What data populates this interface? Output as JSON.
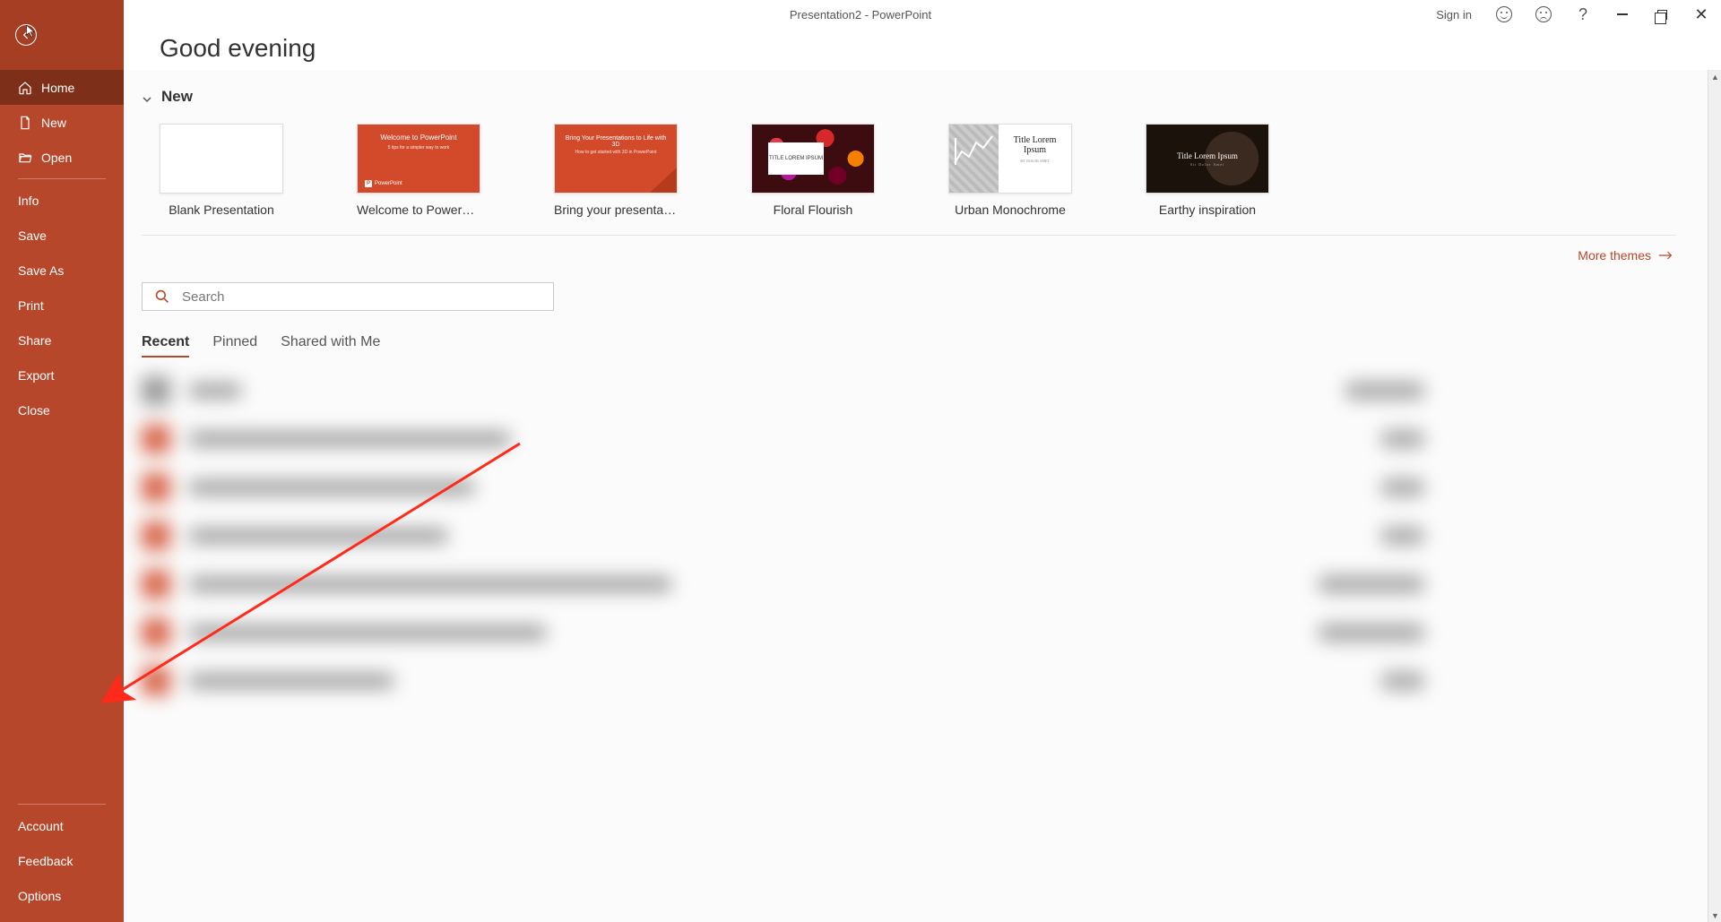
{
  "titlebar": {
    "title": "Presentation2  -  PowerPoint",
    "signin": "Sign in"
  },
  "sidebar": {
    "primary": [
      {
        "label": "Home",
        "icon": "home",
        "active": true
      },
      {
        "label": "New",
        "icon": "new",
        "active": false
      },
      {
        "label": "Open",
        "icon": "open",
        "active": false
      }
    ],
    "secondary": [
      {
        "label": "Info"
      },
      {
        "label": "Save"
      },
      {
        "label": "Save As"
      },
      {
        "label": "Print"
      },
      {
        "label": "Share"
      },
      {
        "label": "Export"
      },
      {
        "label": "Close"
      }
    ],
    "bottom": [
      {
        "label": "Account"
      },
      {
        "label": "Feedback"
      },
      {
        "label": "Options"
      }
    ]
  },
  "main": {
    "greeting": "Good evening",
    "new_section": "New",
    "templates": [
      {
        "label": "Blank Presentation",
        "kind": "blank"
      },
      {
        "label": "Welcome to PowerPoint",
        "kind": "welcome",
        "thumb_t1": "Welcome to PowerPoint",
        "thumb_t2": "5 tips for a simpler way to work",
        "thumb_logo": "PowerPoint"
      },
      {
        "label": "Bring your presentations to...",
        "kind": "bring",
        "thumb_t1": "Bring Your Presentations to Life with 3D",
        "thumb_t2": "How to get started with 3D in PowerPoint"
      },
      {
        "label": "Floral Flourish",
        "kind": "floral",
        "thumb_t1": "TITLE LOREM IPSUM"
      },
      {
        "label": "Urban Monochrome",
        "kind": "urban",
        "thumb_t1": "Title Lorem Ipsum",
        "thumb_t2": "SIT DOLOR AMET"
      },
      {
        "label": "Earthy inspiration",
        "kind": "earthy",
        "thumb_t1": "Title Lorem Ipsum",
        "thumb_t2": "Sit Dolor Amet"
      }
    ],
    "more_themes": "More themes",
    "search_placeholder": "Search",
    "tabs": [
      {
        "label": "Recent",
        "active": true
      },
      {
        "label": "Pinned",
        "active": false
      },
      {
        "label": "Shared with Me",
        "active": false
      }
    ]
  }
}
